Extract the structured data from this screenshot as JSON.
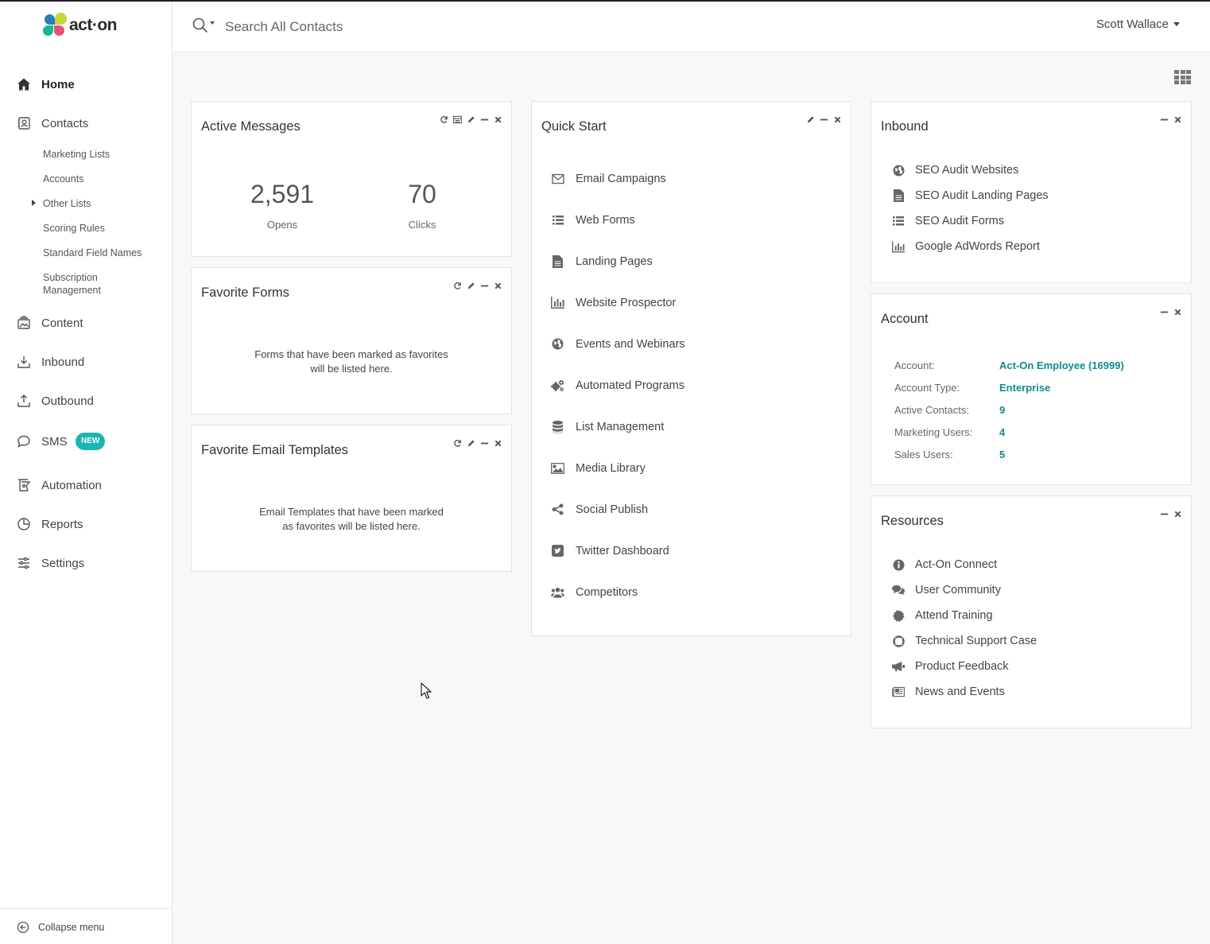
{
  "brand": {
    "name": "act·on",
    "colors": {
      "accent": "#0f8a8f",
      "badge": "#1bb5b5"
    }
  },
  "nav": {
    "home": "Home",
    "contacts": "Contacts",
    "contacts_sub": [
      "Marketing Lists",
      "Accounts",
      "Other Lists",
      "Scoring Rules",
      "Standard Field Names",
      "Subscription",
      "Management"
    ],
    "content": "Content",
    "inbound": "Inbound",
    "outbound": "Outbound",
    "sms": "SMS",
    "sms_badge": "NEW",
    "automation": "Automation",
    "reports": "Reports",
    "settings": "Settings",
    "collapse": "Collapse menu"
  },
  "topbar": {
    "search_placeholder": "Search All Contacts",
    "user": "Scott Wallace"
  },
  "active_messages": {
    "title": "Active Messages",
    "opens_value": "2,591",
    "opens_label": "Opens",
    "clicks_value": "70",
    "clicks_label": "Clicks"
  },
  "favorite_forms": {
    "title": "Favorite Forms",
    "empty_line1": "Forms that have been marked as favorites",
    "empty_line2": "will be listed here."
  },
  "favorite_templates": {
    "title": "Favorite Email Templates",
    "empty_line1": "Email Templates that have been marked",
    "empty_line2": "as favorites will be listed here."
  },
  "quick_start": {
    "title": "Quick Start",
    "items": [
      {
        "label": "Email Campaigns",
        "icon": "envelope-icon"
      },
      {
        "label": "Web Forms",
        "icon": "list-icon"
      },
      {
        "label": "Landing Pages",
        "icon": "document-icon"
      },
      {
        "label": "Website Prospector",
        "icon": "bar-chart-icon"
      },
      {
        "label": "Events and Webinars",
        "icon": "globe-icon"
      },
      {
        "label": "Automated Programs",
        "icon": "gears-icon"
      },
      {
        "label": "List Management",
        "icon": "database-icon"
      },
      {
        "label": "Media Library",
        "icon": "image-icon"
      },
      {
        "label": "Social Publish",
        "icon": "share-icon"
      },
      {
        "label": "Twitter Dashboard",
        "icon": "twitter-square-icon"
      },
      {
        "label": "Competitors",
        "icon": "users-icon"
      }
    ]
  },
  "inbound": {
    "title": "Inbound",
    "items": [
      {
        "label": "SEO Audit Websites",
        "icon": "globe-icon"
      },
      {
        "label": "SEO Audit Landing Pages",
        "icon": "document-icon"
      },
      {
        "label": "SEO Audit Forms",
        "icon": "list-icon"
      },
      {
        "label": "Google AdWords Report",
        "icon": "bar-chart-icon"
      }
    ]
  },
  "account": {
    "title": "Account",
    "rows": [
      {
        "key": "Account:",
        "value": "Act-On Employee (16999)"
      },
      {
        "key": "Account Type:",
        "value": "Enterprise"
      },
      {
        "key": "Active Contacts:",
        "value": "9"
      },
      {
        "key": "Marketing Users:",
        "value": "4"
      },
      {
        "key": "Sales Users:",
        "value": "5"
      }
    ]
  },
  "resources": {
    "title": "Resources",
    "items": [
      {
        "label": "Act-On Connect",
        "icon": "info-circle-icon"
      },
      {
        "label": "User Community",
        "icon": "chat-bubbles-icon"
      },
      {
        "label": "Attend Training",
        "icon": "badge-icon"
      },
      {
        "label": "Technical Support Case",
        "icon": "lifebuoy-icon"
      },
      {
        "label": "Product Feedback",
        "icon": "megaphone-icon"
      },
      {
        "label": "News and Events",
        "icon": "newspaper-icon"
      }
    ]
  }
}
